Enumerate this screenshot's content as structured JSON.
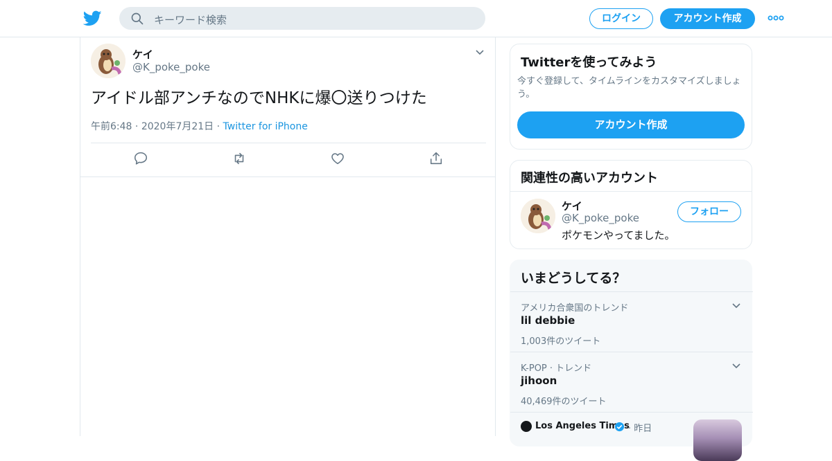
{
  "header": {
    "search_placeholder": "キーワード検索",
    "login_label": "ログイン",
    "signup_label": "アカウント作成"
  },
  "tweet": {
    "author_name": "ケイ",
    "author_handle": "@K_poke_poke",
    "text": "アイドル部アンチなのでNHKに爆〇送りつけた",
    "time": "午前6:48",
    "date": "2020年7月21日",
    "source": "Twitter for iPhone"
  },
  "signup_card": {
    "title": "Twitterを使ってみよう",
    "description": "今すぐ登録して、タイムラインをカスタマイズしましょう。",
    "button_label": "アカウント作成"
  },
  "related": {
    "title": "関連性の高いアカウント",
    "name": "ケイ",
    "handle": "@K_poke_poke",
    "bio": "ポケモンやってました。",
    "follow_label": "フォロー"
  },
  "trends": {
    "title": "いまどうしてる？",
    "items": [
      {
        "category": "アメリカ合衆国のトレンド",
        "name": "lil debbie",
        "count": "1,003件のツイート"
      },
      {
        "category": "K-POP · トレンド",
        "name": "jihoon",
        "count": "40,469件のツイート"
      }
    ],
    "news": {
      "source": "Los Angeles Times",
      "time": "· 昨日"
    }
  },
  "colors": {
    "accent": "#1da1f2",
    "border": "#e1e8ed",
    "muted": "#657786"
  }
}
